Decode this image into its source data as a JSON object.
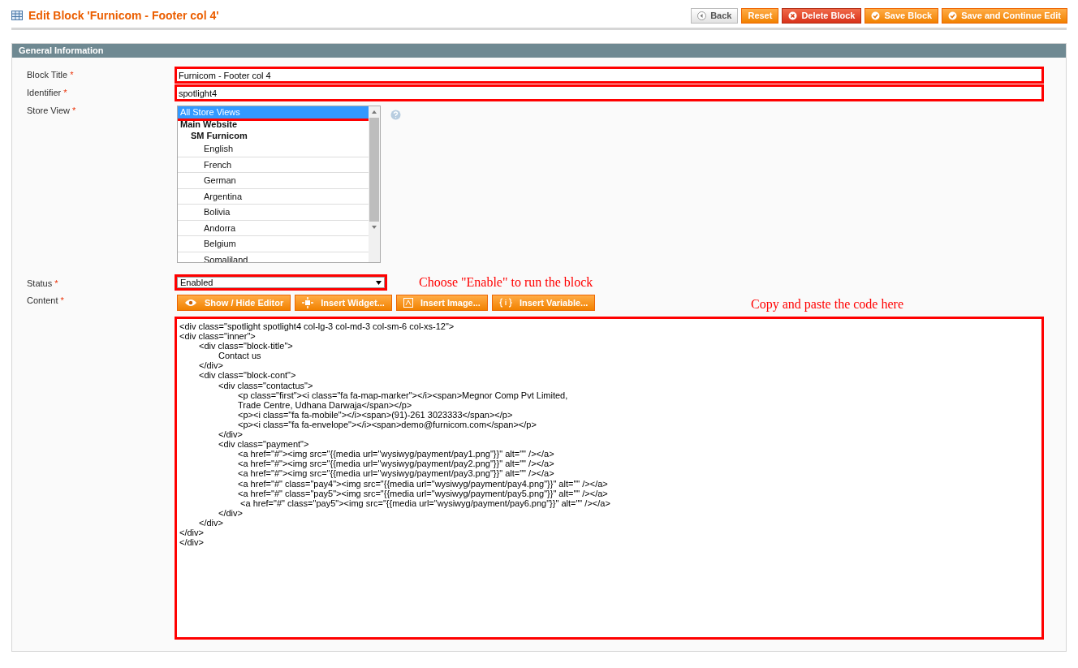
{
  "page_title": "Edit Block 'Furnicom - Footer col 4'",
  "buttons": [
    {
      "label": "Back",
      "kind": "back"
    },
    {
      "label": "Reset",
      "kind": "plain"
    },
    {
      "label": "Delete Block",
      "kind": "delete"
    },
    {
      "label": "Save Block",
      "kind": "save"
    },
    {
      "label": "Save and Continue Edit",
      "kind": "save"
    }
  ],
  "section": {
    "title": "General Information",
    "block_title": {
      "label": "Block Title",
      "required_mark": "*",
      "value": "Furnicom - Footer col 4",
      "highlighted": true
    },
    "identifier": {
      "label": "Identifier",
      "required_mark": "*",
      "value": "spotlight4",
      "highlighted": true
    },
    "store_view": {
      "label": "Store View",
      "required_mark": "*",
      "options": [
        {
          "label": "All Store Views",
          "kind": "option",
          "selected": true,
          "highlighted": true
        },
        {
          "label": "Main Website",
          "kind": "group",
          "selected": false,
          "children": [
            {
              "label": "SM Furnicom",
              "kind": "group",
              "selected": false,
              "children": [
                {
                  "label": "English",
                  "kind": "option",
                  "selected": false
                },
                {
                  "label": "French",
                  "kind": "option",
                  "selected": false
                },
                {
                  "label": "German",
                  "kind": "option",
                  "selected": false
                },
                {
                  "label": "Argentina",
                  "kind": "option",
                  "selected": false
                },
                {
                  "label": "Bolivia",
                  "kind": "option",
                  "selected": false
                },
                {
                  "label": "Andorra",
                  "kind": "option",
                  "selected": false
                },
                {
                  "label": "Belgium",
                  "kind": "option",
                  "selected": false
                },
                {
                  "label": "Somaliland",
                  "kind": "option",
                  "selected": false
                }
              ]
            }
          ]
        }
      ]
    },
    "status": {
      "label": "Status",
      "required_mark": "*",
      "value": "Enabled",
      "highlighted": true,
      "annotation": "Choose \"Enable\" to run the block"
    },
    "content": {
      "label": "Content",
      "required_mark": "*",
      "highlighted": true,
      "annotation": "Copy and paste the code here",
      "editor_buttons": [
        {
          "label": "Show / Hide Editor",
          "kind": "eye"
        },
        {
          "label": "Insert Widget...",
          "kind": "widget"
        },
        {
          "label": "Insert Image...",
          "kind": "image"
        },
        {
          "label": "Insert Variable...",
          "kind": "variable"
        }
      ],
      "value": "<div class=\"spotlight spotlight4 col-lg-3 col-md-3 col-sm-6 col-xs-12\">\n<div class=\"inner\">\n\t<div class=\"block-title\">\n\t\tContact us\n\t</div>\n\t<div class=\"block-cont\">\n\t\t<div class=\"contactus\">\n\t\t\t<p class=\"first\"><i class=\"fa fa-map-marker\"></i><span>Megnor Comp Pvt Limited,\n\t\t\tTrade Centre, Udhana Darwaja</span></p>\n\t\t\t<p><i class=\"fa fa-mobile\"></i><span>(91)-261 3023333</span></p>\n\t\t\t<p><i class=\"fa fa-envelope\"></i><span>demo@furnicom.com</span></p>\n\t\t</div>\n\t\t<div class=\"payment\">\n\t\t\t<a href=\"#\"><img src=\"{{media url=\"wysiwyg/payment/pay1.png\"}}\" alt=\"\" /></a>\n\t\t\t<a href=\"#\"><img src=\"{{media url=\"wysiwyg/payment/pay2.png\"}}\" alt=\"\" /></a>\n\t\t\t<a href=\"#\"><img src=\"{{media url=\"wysiwyg/payment/pay3.png\"}}\" alt=\"\" /></a>\n\t\t\t<a href=\"#\" class=\"pay4\"><img src=\"{{media url=\"wysiwyg/payment/pay4.png\"}}\" alt=\"\" /></a>\n\t\t\t<a href=\"#\" class=\"pay5\"><img src=\"{{media url=\"wysiwyg/payment/pay5.png\"}}\" alt=\"\" /></a>\n\t\t\t <a href=\"#\" class=\"pay5\"><img src=\"{{media url=\"wysiwyg/payment/pay6.png\"}}\" alt=\"\" /></a>\n\t\t</div>\n\t</div>\n</div>\n</div>"
    }
  }
}
